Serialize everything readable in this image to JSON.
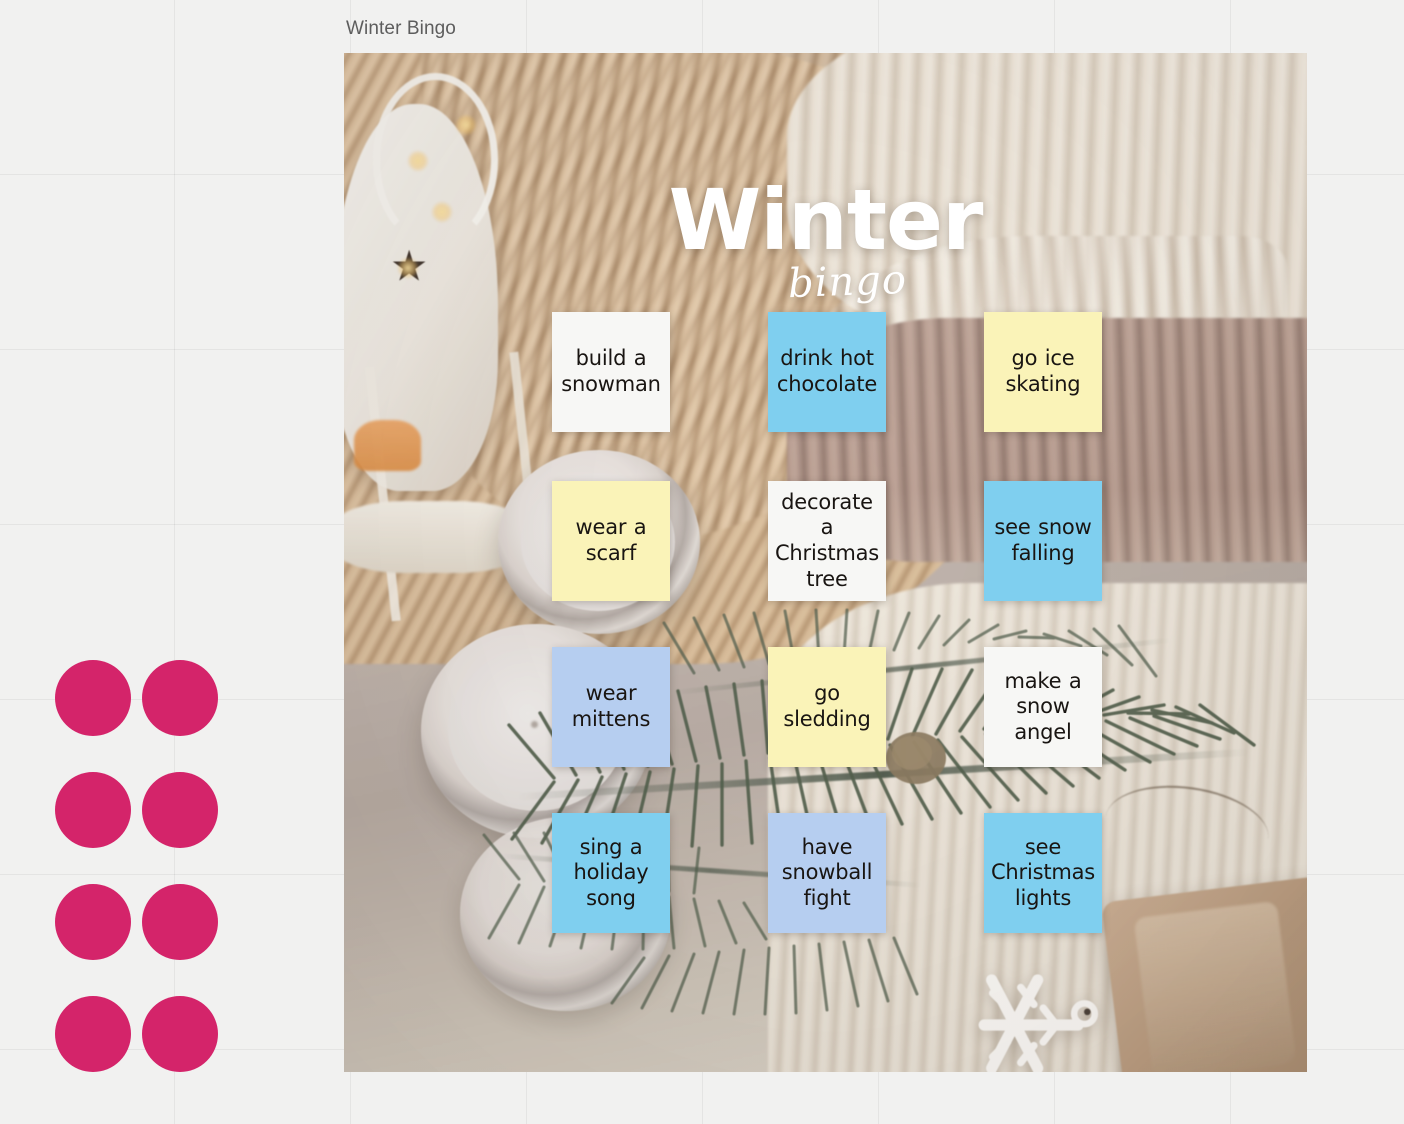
{
  "page": {
    "title": "Winter Bingo",
    "background_color": "#f1f1f0",
    "grid_line_color": "#e3e3e2"
  },
  "decoration": {
    "dot_grid": {
      "name": "pink-dot-grid",
      "color": "#D4246A",
      "rows": 4,
      "columns": 2,
      "count": 8
    }
  },
  "poster": {
    "headline": {
      "main": "Winter",
      "sub": "bingo",
      "color": "#ffffff"
    },
    "photo": {
      "description": "cozy winter flat-lay: knitted sweaters, white lantern with star cutout, glass candles, fir branch, snowflake ornament, kraft-paper gift",
      "objects": [
        "knitted-sweaters",
        "white-lantern",
        "star-cutout",
        "fairy-lights",
        "glass-candle-jars",
        "fir-branch",
        "snowflake-ornament",
        "kraft-paper-gift"
      ]
    },
    "card_colors": {
      "white": "#f7f7f5",
      "blue": "#7fcfef",
      "yellow": "#faf3b8",
      "periwinkle": "#b6cef0"
    },
    "bingo_cards": [
      {
        "text": "build a snowman",
        "color": "#f7f7f5",
        "row": 1,
        "col": 1
      },
      {
        "text": "drink hot chocolate",
        "color": "#7fcfef",
        "row": 1,
        "col": 2
      },
      {
        "text": "go ice skating",
        "color": "#faf3b8",
        "row": 1,
        "col": 3
      },
      {
        "text": "wear a scarf",
        "color": "#faf3b8",
        "row": 2,
        "col": 1
      },
      {
        "text": "decorate a Christmas tree",
        "color": "#f7f7f5",
        "row": 2,
        "col": 2
      },
      {
        "text": "see snow falling",
        "color": "#7fcfef",
        "row": 2,
        "col": 3
      },
      {
        "text": "wear mittens",
        "color": "#b6cef0",
        "row": 3,
        "col": 1
      },
      {
        "text": "go sledding",
        "color": "#faf3b8",
        "row": 3,
        "col": 2
      },
      {
        "text": "make a snow angel",
        "color": "#f7f7f5",
        "row": 3,
        "col": 3
      },
      {
        "text": "sing a holiday song",
        "color": "#7fcfef",
        "row": 4,
        "col": 1
      },
      {
        "text": "have snowball fight",
        "color": "#b6cef0",
        "row": 4,
        "col": 2
      },
      {
        "text": "see Christmas lights",
        "color": "#7fcfef",
        "row": 4,
        "col": 3
      }
    ]
  }
}
